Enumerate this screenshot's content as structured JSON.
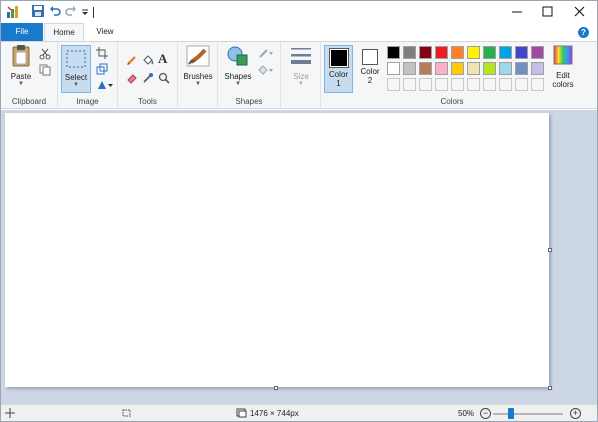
{
  "ribbon_tabs": {
    "file": "File",
    "home": "Home",
    "view": "View"
  },
  "help": "?",
  "clipboard": {
    "paste": "Paste",
    "label": "Clipboard"
  },
  "image": {
    "select": "Select",
    "label": "Image"
  },
  "tools": {
    "text": "A",
    "label": "Tools"
  },
  "brushes": {
    "label": "Brushes"
  },
  "shapes": {
    "label": "Shapes",
    "group_label": "Shapes"
  },
  "size": {
    "label": "Size"
  },
  "colors": {
    "color1_line1": "Color",
    "color1_line2": "1",
    "color2_line1": "Color",
    "color2_line2": "2",
    "edit_line1": "Edit",
    "edit_line2": "colors",
    "label": "Colors",
    "color1_value": "#000000",
    "color2_value": "#ffffff",
    "palette_row1": [
      "#000000",
      "#7f7f7f",
      "#880015",
      "#ed1c24",
      "#ff7f27",
      "#fff200",
      "#22b14c",
      "#00a2e8",
      "#3f48cc",
      "#a349a4"
    ],
    "palette_row2": [
      "#ffffff",
      "#c3c3c3",
      "#b97a57",
      "#ffaec9",
      "#ffc90e",
      "#efe4b0",
      "#b5e61d",
      "#99d9ea",
      "#7092be",
      "#c8bfe7"
    ]
  },
  "status": {
    "dimensions": "1476 × 744px",
    "zoom": "50%",
    "zoom_fraction": 0.5
  }
}
